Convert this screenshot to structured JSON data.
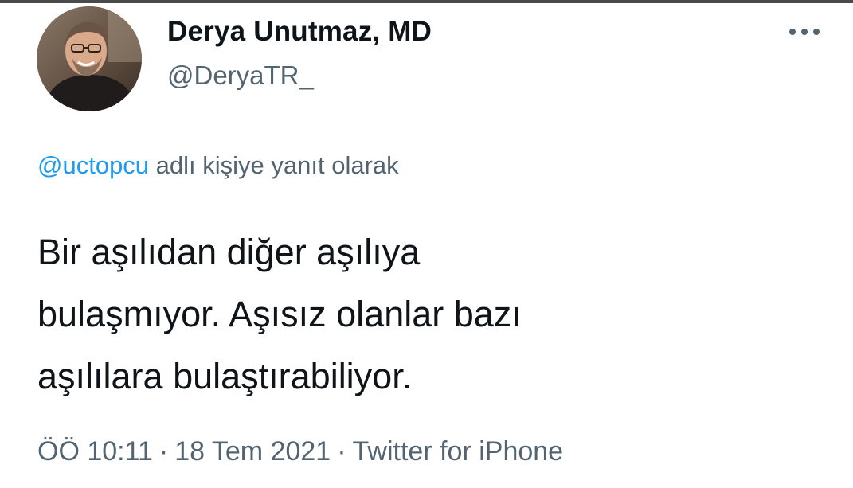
{
  "author": {
    "display_name": "Derya Unutmaz, MD",
    "handle": "@DeryaTR_"
  },
  "menu": {
    "more_icon": "more-horizontal-icon"
  },
  "reply": {
    "mention": "@uctopcu",
    "suffix": " adlı kişiye yanıt olarak"
  },
  "tweet": {
    "lines": [
      "Bir aşılıdan diğer aşılıya",
      "bulaşmıyor. Aşısız olanlar bazı",
      "aşılılara bulaştırabiliyor."
    ]
  },
  "meta": {
    "time": "ÖÖ 10:11",
    "separator": "·",
    "date": "18 Tem 2021",
    "source": "Twitter for iPhone"
  },
  "colors": {
    "text_primary": "#0f1419",
    "text_secondary": "#536471",
    "link": "#1d9bf0"
  }
}
